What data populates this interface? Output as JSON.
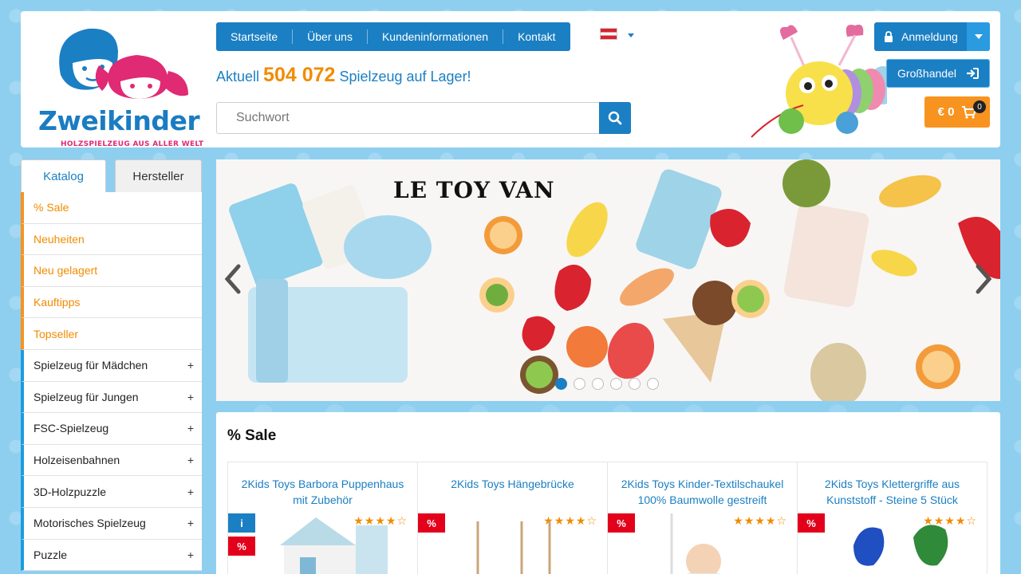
{
  "header": {
    "logo_text": "Zweikinder",
    "logo_tagline": "HOLZSPIELZEUG AUS ALLER WELT",
    "nav": [
      "Startseite",
      "Über uns",
      "Kundeninformationen",
      "Kontakt"
    ],
    "stock_prefix": "Aktuell",
    "stock_number": "504 072",
    "stock_suffix": "Spielzeug auf Lager!",
    "search_placeholder": "Suchwort",
    "login_label": "Anmeldung",
    "wholesale_label": "Großhandel",
    "cart_label": "€ 0",
    "cart_count": "0",
    "language_flag": "Austria"
  },
  "sidebar": {
    "tabs": [
      "Katalog",
      "Hersteller"
    ],
    "items": [
      {
        "label": "% Sale",
        "plus": ""
      },
      {
        "label": "Neuheiten",
        "plus": ""
      },
      {
        "label": "Neu gelagert",
        "plus": ""
      },
      {
        "label": "Kauftipps",
        "plus": ""
      },
      {
        "label": "Topseller",
        "plus": ""
      },
      {
        "label": "Spielzeug für Mädchen",
        "plus": "+"
      },
      {
        "label": "Spielzeug für Jungen",
        "plus": "+"
      },
      {
        "label": "FSC-Spielzeug",
        "plus": "+"
      },
      {
        "label": "Holzeisenbahnen",
        "plus": "+"
      },
      {
        "label": "3D-Holzpuzzle",
        "plus": "+"
      },
      {
        "label": "Motorisches Spielzeug",
        "plus": "+"
      },
      {
        "label": "Puzzle",
        "plus": "+"
      }
    ]
  },
  "slider": {
    "brand": "LE TOY VAN",
    "dots": 6,
    "active_dot": 0
  },
  "sale": {
    "title": "% Sale",
    "products": [
      {
        "name": "2Kids Toys Barbora Puppenhaus mit Zubehör",
        "stars": "★★★★☆",
        "badges": [
          "i",
          "%"
        ]
      },
      {
        "name": "2Kids Toys Hängebrücke",
        "stars": "★★★★☆",
        "badges": [
          "%"
        ]
      },
      {
        "name": "2Kids Toys Kinder-Textilschaukel 100% Baumwolle gestreift",
        "stars": "★★★★☆",
        "badges": [
          "%"
        ]
      },
      {
        "name": "2Kids Toys Klettergriffe aus Kunststoff - Steine 5 Stück",
        "stars": "★★★★☆",
        "badges": [
          "%"
        ]
      }
    ]
  },
  "colors": {
    "primary": "#1b7fc3",
    "accent": "#f7931e",
    "sale": "#e3001b",
    "background": "#8ecff0"
  }
}
